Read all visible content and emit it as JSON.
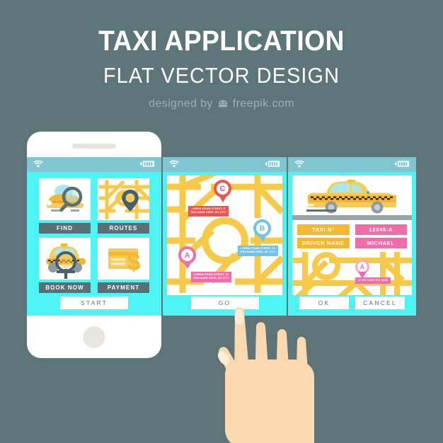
{
  "theme": {
    "background": "#5d7579",
    "screen_cyan": "#4ef4f4",
    "statusbar": "#7fc6d0",
    "label_slate": "#5c6f77",
    "road_yellow": "#f7c948",
    "marker_red": "#ef5350",
    "marker_blue": "#6fc3ea",
    "marker_pink": "#ee6fa8",
    "chip_amber": "#f5b731",
    "skin": "#fad9b0"
  },
  "header": {
    "title": "TAXI APPLICATION",
    "subtitle": "FLAT VECTOR DESIGN",
    "credit_prefix": "designed by",
    "credit_brand": "freepik.com"
  },
  "screen1": {
    "statusbar": {
      "wifi_icon": "wifi-icon",
      "battery_icon": "battery-icon"
    },
    "tiles": [
      {
        "label": "FIND",
        "icon": "taxi-search-icon"
      },
      {
        "label": "ROUTES",
        "icon": "map-pin-icon"
      },
      {
        "label": "BOOK NOW",
        "icon": "taxi-booking-icon"
      },
      {
        "label": "PAYMENT",
        "icon": "credit-card-dollar-icon"
      }
    ],
    "cta": "START"
  },
  "screen2": {
    "statusbar": {
      "wifi_icon": "wifi-icon",
      "battery_icon": "battery-icon"
    },
    "markers": [
      {
        "id": "C",
        "color": "#ef5350",
        "line1": "LOREM IPSUM STREET, 5",
        "line2": "7054 NAME HERE, MY CITY"
      },
      {
        "id": "B",
        "color": "#6fc3ea",
        "line1": "LOREM IPSUM STREET, 15",
        "line2": "7054 NAME HERE, MY CITY"
      },
      {
        "id": "A",
        "color": "#ee6fa8",
        "line1": "LOREM IPSUM STREET, 20",
        "line2": "7054 NAME HERE, MY CITY"
      }
    ],
    "cta": "GO"
  },
  "screen3": {
    "statusbar": {
      "wifi_icon": "wifi-icon",
      "battery_icon": "battery-icon"
    },
    "car_icon": "yellow-taxi-icon",
    "info": [
      {
        "label": "TAXI Nº",
        "value": "12345-A"
      },
      {
        "label": "DRIVER NAME",
        "value": "MICHAEL"
      }
    ],
    "map_marker": {
      "id": "A",
      "callout": "10 MIN YOUR TEXT HERE"
    },
    "buttons": {
      "ok": "OK",
      "cancel": "CANCEL"
    }
  },
  "hand": {
    "icon": "pointing-hand-icon"
  }
}
